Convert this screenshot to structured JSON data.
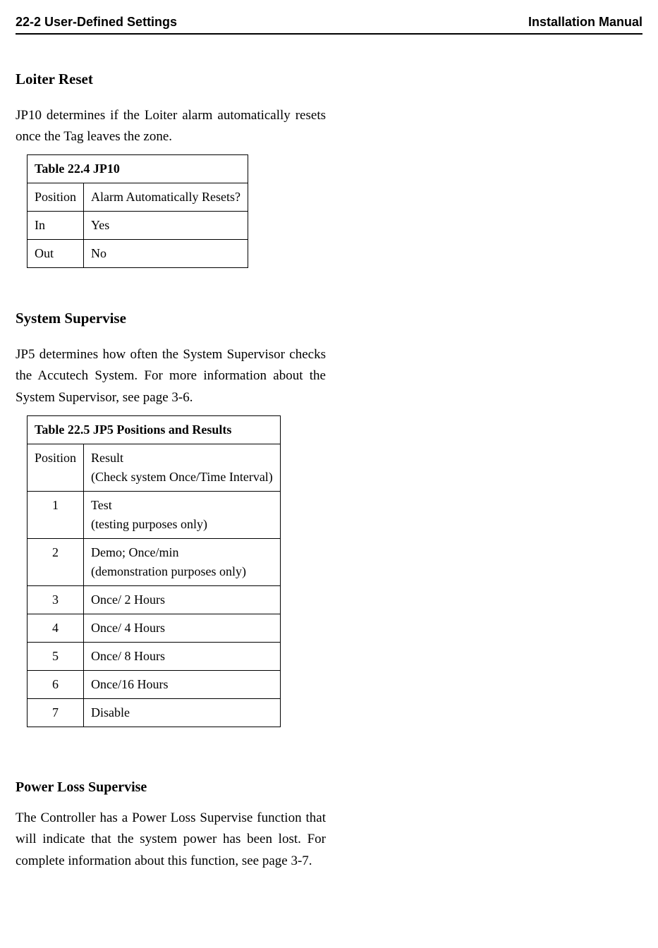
{
  "header": {
    "left": "22-2 User-Defined Settings",
    "right": "Installation Manual"
  },
  "section1": {
    "title": "Loiter Reset",
    "body": "JP10 determines if the Loiter alarm automatically resets once the Tag leaves the zone."
  },
  "table1": {
    "caption": "Table 22.4 JP10",
    "col1": "Position",
    "col2": "Alarm Automatically Resets?",
    "rows": [
      {
        "c1": "In",
        "c2": "Yes"
      },
      {
        "c1": "Out",
        "c2": "No"
      }
    ]
  },
  "section2": {
    "title": "System Supervise",
    "body": "JP5 determines how often the System Supervisor checks the Accutech System. For more information about the System Supervisor, see page 3-6."
  },
  "table2": {
    "caption": "Table 22.5 JP5 Positions and Results",
    "col1": "Position",
    "col2a": "Result",
    "col2b": "(Check system Once/Time Interval)",
    "rows": [
      {
        "c1": "1",
        "c2a": "Test",
        "c2b": "(testing purposes only)"
      },
      {
        "c1": "2",
        "c2a": "Demo; Once/min",
        "c2b": "(demonstration purposes only)"
      },
      {
        "c1": "3",
        "c2a": "Once/ 2 Hours",
        "c2b": ""
      },
      {
        "c1": "4",
        "c2a": "Once/ 4 Hours",
        "c2b": ""
      },
      {
        "c1": "5",
        "c2a": "Once/ 8 Hours",
        "c2b": ""
      },
      {
        "c1": "6",
        "c2a": "Once/16 Hours",
        "c2b": ""
      },
      {
        "c1": "7",
        "c2a": "Disable",
        "c2b": ""
      }
    ]
  },
  "section3": {
    "title": "Power Loss Supervise",
    "body": "The Controller has a Power Loss Supervise function that will indicate that the system power has been lost. For complete information about this function, see page 3-7."
  }
}
